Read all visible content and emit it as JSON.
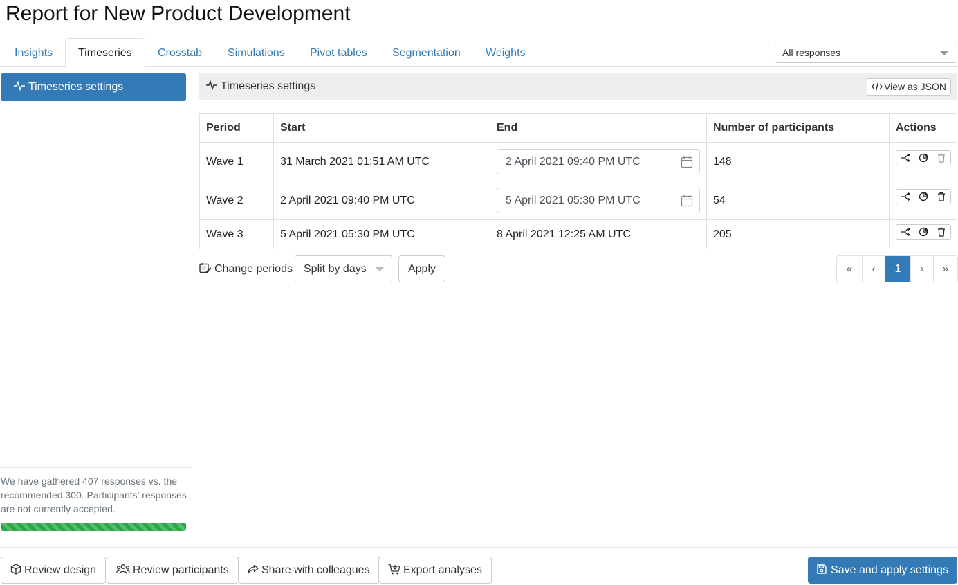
{
  "page": {
    "title": "Report for New Product Development"
  },
  "tabs": [
    {
      "label": "Insights"
    },
    {
      "label": "Timeseries"
    },
    {
      "label": "Crosstab"
    },
    {
      "label": "Simulations"
    },
    {
      "label": "Pivot tables"
    },
    {
      "label": "Segmentation"
    },
    {
      "label": "Weights"
    }
  ],
  "active_tab": "Timeseries",
  "responses_filter": {
    "selected": "All responses"
  },
  "sidebar": {
    "item": {
      "label": "Timeseries settings",
      "icon": "activity-icon"
    },
    "note": "We have gathered 407 responses vs. the recommended 300. Participants' responses are not currently accepted.",
    "progress": {
      "percent": 100,
      "color": "#28a745"
    }
  },
  "panel": {
    "title": "Timeseries settings",
    "json_button": "View as JSON"
  },
  "table": {
    "headers": {
      "period": "Period",
      "start": "Start",
      "end": "End",
      "participants": "Number of participants",
      "actions": "Actions"
    },
    "rows": [
      {
        "period": "Wave 1",
        "start": "31 March 2021 01:51 AM UTC",
        "end": "2 April 2021 09:40 PM UTC",
        "participants": "148"
      },
      {
        "period": "Wave 2",
        "start": "2 April 2021 09:40 PM UTC",
        "end": "5 April 2021 05:30 PM UTC",
        "participants": "54"
      },
      {
        "period": "Wave 3",
        "start": "5 April 2021 05:30 PM UTC",
        "end": "8 April 2021 12:25 AM UTC",
        "participants": "205"
      }
    ],
    "action_icons": [
      "split-icon",
      "pie-chart-icon",
      "trash-icon"
    ]
  },
  "periods": {
    "label": "Change periods",
    "split_select": "Split by days",
    "apply": "Apply"
  },
  "pagination": {
    "first": "«",
    "prev": "‹",
    "current": "1",
    "next": "›",
    "last": "»"
  },
  "footer": {
    "review_design": "Review design",
    "review_participants": "Review participants",
    "share": "Share with colleagues",
    "export": "Export analyses",
    "save": "Save and apply settings"
  },
  "colors": {
    "primary": "#337ab7",
    "success": "#28a745",
    "panel_bg": "#eeeeee"
  }
}
